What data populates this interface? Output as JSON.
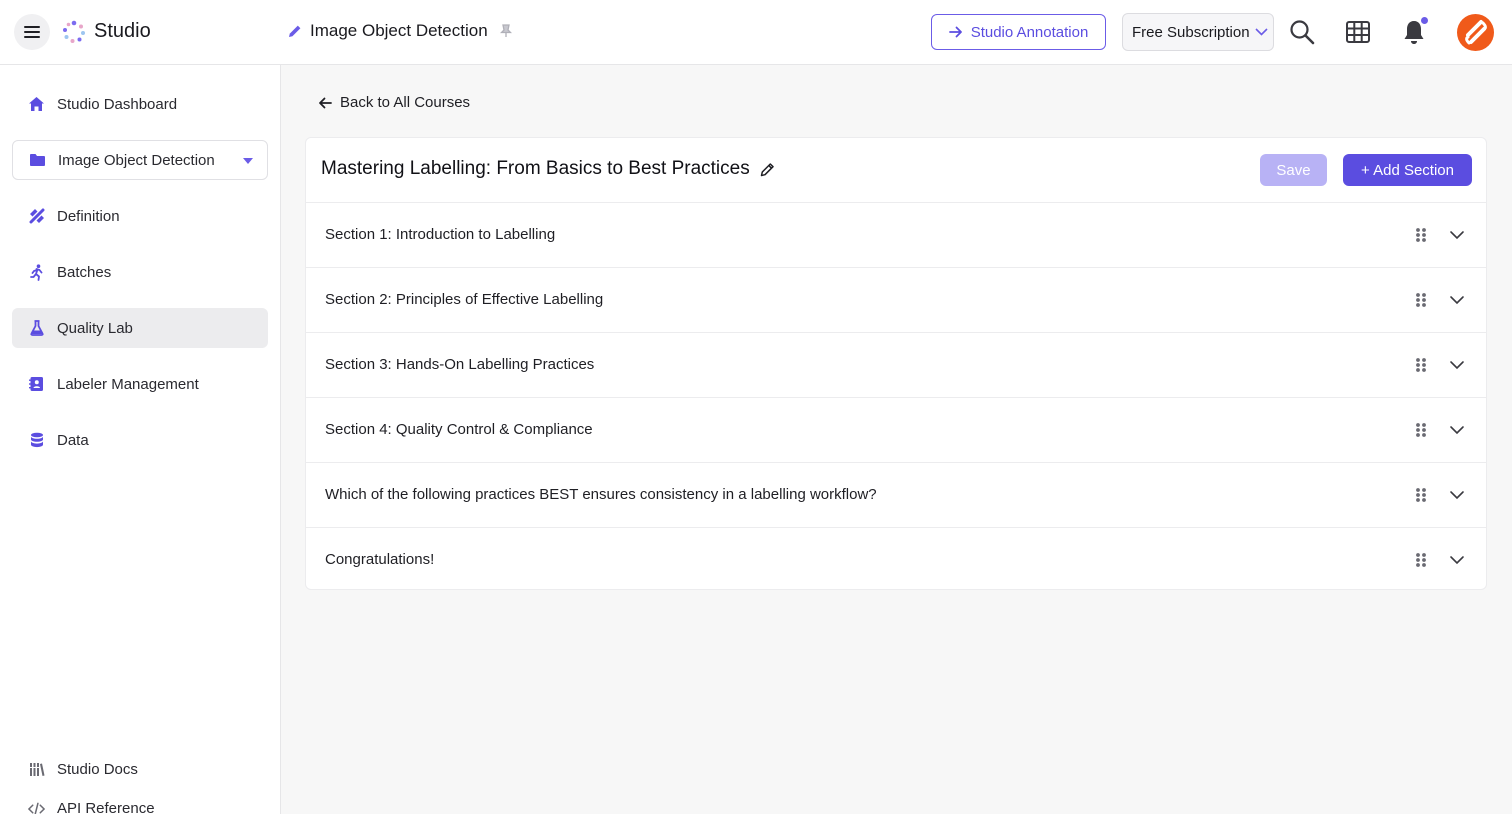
{
  "header": {
    "brand": "Studio",
    "project_title": "Image Object Detection",
    "annotation_button": "Studio Annotation",
    "subscription": "Free Subscription"
  },
  "sidebar": {
    "items": [
      {
        "label": "Studio Dashboard",
        "icon": "home-icon"
      },
      {
        "label": "Image Object Detection",
        "icon": "folder-icon"
      },
      {
        "label": "Definition",
        "icon": "design-tools-icon"
      },
      {
        "label": "Batches",
        "icon": "running-person-icon"
      },
      {
        "label": "Quality Lab",
        "icon": "flask-icon",
        "active": true
      },
      {
        "label": "Labeler Management",
        "icon": "contact-book-icon"
      },
      {
        "label": "Data",
        "icon": "database-icon"
      }
    ],
    "footer": [
      {
        "label": "Studio Docs",
        "icon": "library-icon"
      },
      {
        "label": "API Reference",
        "icon": "code-icon"
      }
    ]
  },
  "main": {
    "back_label": "Back to All Courses",
    "course_title": "Mastering Labelling: From Basics to Best Practices",
    "save_label": "Save",
    "add_section_label": "+ Add Section",
    "sections": [
      "Section 1: Introduction to Labelling",
      "Section 2: Principles of Effective Labelling",
      "Section 3: Hands-On Labelling Practices",
      "Section 4: Quality Control & Compliance",
      "Which of the following practices BEST ensures consistency in a labelling workflow?",
      "Congratulations!"
    ]
  },
  "colors": {
    "accent": "#5b4de0",
    "accent_light": "#b8b2f5",
    "avatar": "#f05a1a"
  }
}
